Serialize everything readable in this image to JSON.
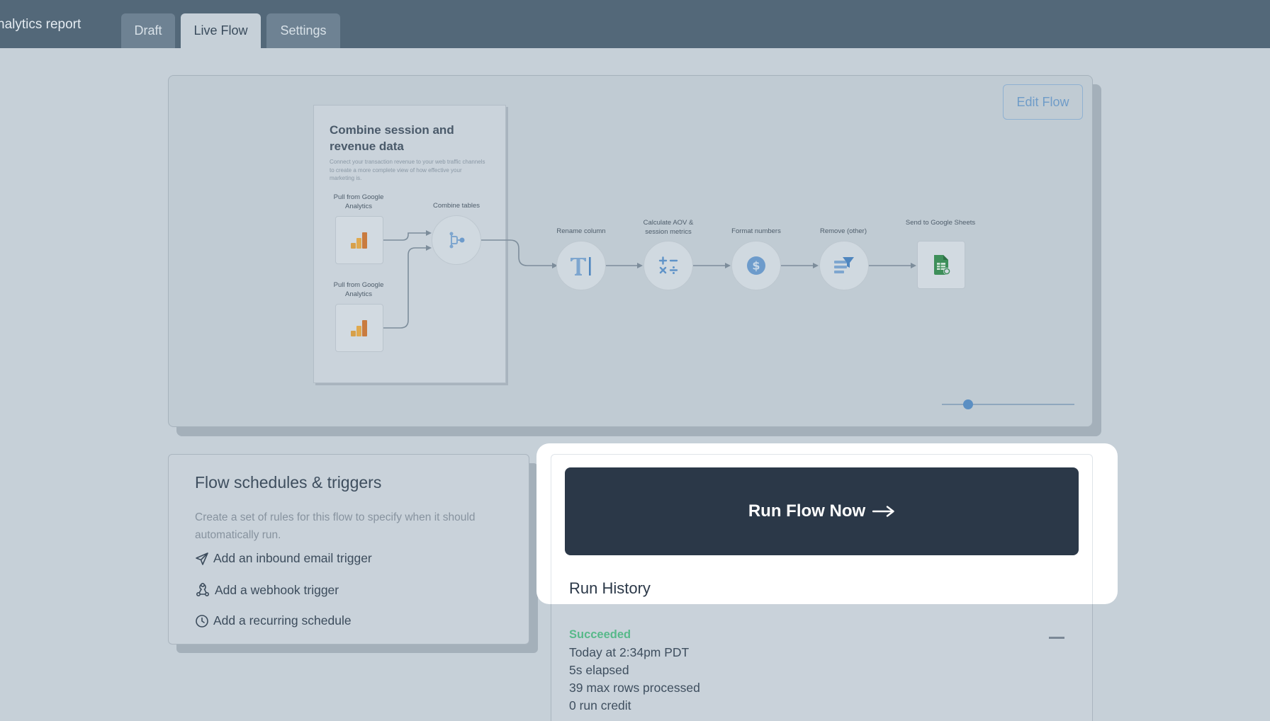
{
  "header": {
    "title": "nalytics report",
    "tabs": [
      {
        "label": "Draft"
      },
      {
        "label": "Live Flow"
      },
      {
        "label": "Settings"
      }
    ]
  },
  "canvas": {
    "edit_label": "Edit Flow",
    "group": {
      "title": "Combine session and revenue data",
      "description": "Connect your transaction revenue to your web traffic channels to create a more complete view of how effective your marketing is."
    },
    "nodes": [
      {
        "label": "Pull from Google Analytics",
        "icon": "google-analytics-icon"
      },
      {
        "label": "Pull from Google Analytics",
        "icon": "google-analytics-icon"
      },
      {
        "label": "Combine tables",
        "icon": "merge-icon"
      },
      {
        "label": "Rename column",
        "icon": "text-cursor-icon"
      },
      {
        "label": "Calculate AOV & session metrics",
        "icon": "calculator-icon"
      },
      {
        "label": "Format numbers",
        "icon": "dollar-icon"
      },
      {
        "label": "Remove (other)",
        "icon": "filter-icon"
      },
      {
        "label": "Send to Google Sheets",
        "icon": "google-sheets-icon"
      }
    ],
    "zoom_level": 0.2
  },
  "schedules": {
    "title": "Flow schedules & triggers",
    "description": "Create a set of rules for this flow to specify when it should automatically run.",
    "triggers": [
      {
        "label": "Add an inbound email trigger",
        "icon": "paper-plane-icon"
      },
      {
        "label": "Add a webhook trigger",
        "icon": "webhook-icon"
      },
      {
        "label": "Add a recurring schedule",
        "icon": "clock-icon"
      }
    ]
  },
  "run": {
    "button_label": "Run Flow Now",
    "history_title": "Run History",
    "latest": {
      "status": "Succeeded",
      "time": "Today at 2:34pm PDT",
      "elapsed": "5s elapsed",
      "rows": "39 max rows processed",
      "credit": "0 run credit"
    }
  },
  "colors": {
    "header_bg": "#536879",
    "page_bg": "#c6d0d8",
    "run_button_bg": "#2b3848",
    "success": "#58b98a",
    "accent": "#6f9cc8"
  }
}
